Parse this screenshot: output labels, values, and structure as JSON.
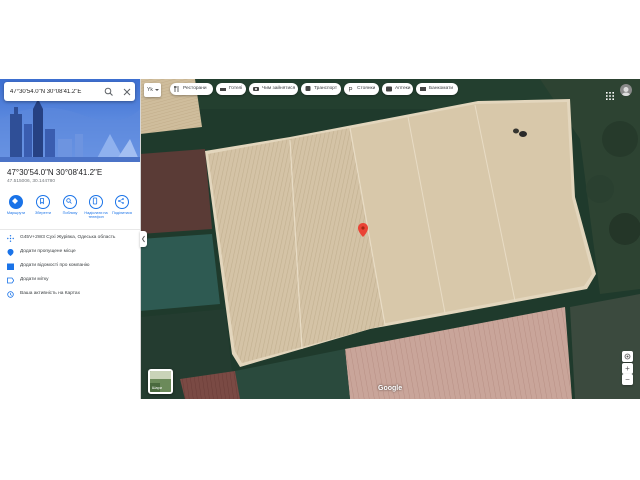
{
  "search": {
    "value": "47°30'54.0\"N 30°08'41.2\"E",
    "search_icon": "search-icon",
    "close_icon": "close-icon"
  },
  "place": {
    "title": "47°30'54.0\"N 30°08'41.2\"E",
    "subtitle": "47.515006, 30.144780"
  },
  "actions": [
    {
      "label": "Маршрути",
      "icon": "directions-icon"
    },
    {
      "label": "Зберегти",
      "icon": "bookmark-icon"
    },
    {
      "label": "Поблизу",
      "icon": "nearby-icon"
    },
    {
      "label": "Надіслати на телефон",
      "icon": "send-to-phone-icon"
    },
    {
      "label": "Поділитися",
      "icon": "share-icon"
    }
  ],
  "info": [
    {
      "text": "G45V+2W3 Сухі Журівка, Одеська область",
      "icon": "plus-code-icon"
    },
    {
      "text": "Додати пропущене місце",
      "icon": "add-place-icon"
    },
    {
      "text": "Додати відомості про компанію",
      "icon": "business-icon"
    },
    {
      "text": "Додати мітку",
      "icon": "label-icon"
    },
    {
      "text": "Ваша активність на Картах",
      "icon": "history-icon"
    }
  ],
  "map": {
    "lang_label": "Yk",
    "chips": [
      {
        "label": "Ресторани",
        "icon": "restaurant-icon"
      },
      {
        "label": "Готелі",
        "icon": "hotel-icon"
      },
      {
        "label": "Чим зайнятися",
        "icon": "camera-icon"
      },
      {
        "label": "Транспорт",
        "icon": "transit-icon"
      },
      {
        "label": "Стоянки",
        "icon": "parking-icon"
      },
      {
        "label": "Аптеки",
        "icon": "pharmacy-icon"
      },
      {
        "label": "Банкомати",
        "icon": "atm-icon"
      }
    ],
    "layers_label": "Шари",
    "logo": "Google",
    "zoom_in": "+",
    "zoom_out": "−",
    "colors": {
      "accent": "#1a73e8",
      "pin": "#ea4335",
      "field_light": "#d2c1a3",
      "field_dark_green": "#2a4a3a"
    }
  }
}
